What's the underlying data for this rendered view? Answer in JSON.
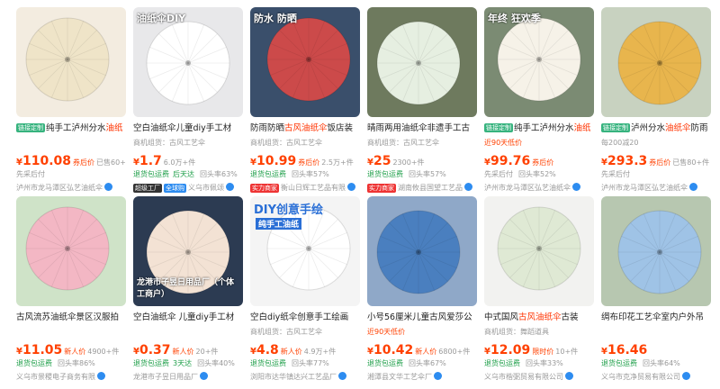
{
  "products": [
    {
      "title_tag": "链接定制",
      "title_pre": "纯手工泸州分水",
      "title_hl": "油纸",
      "sub": "",
      "price": "110.08",
      "price_tag": "券后价",
      "sales": "已售60+件",
      "extra": "先采后付",
      "shop": "泸州市龙马潭区弘艺油纸伞",
      "colors": {
        "bg": "#f3ece0",
        "umb": "#efe4c8"
      }
    },
    {
      "title_tag": "",
      "title_pre": "空白油纸伞儿童diy手工材",
      "title_hl": "",
      "sub": "商机组货：古风工艺伞",
      "price": "1.7",
      "price_tag": "",
      "sales": "6.0万+件",
      "extra_green": "退货包运费",
      "extra_green2": "后天达",
      "extra_right": "回头率63%",
      "shop_badge": "超级工厂",
      "shop_badge2": "全球购",
      "shop": "义乌市佩颂",
      "img_text": "油纸伞DIY",
      "colors": {
        "bg": "#e8e8ea",
        "umb": "#ffffff"
      }
    },
    {
      "title_tag": "",
      "title_pre": "防雨防晒",
      "title_hl": "古风油纸伞",
      "title_post": "饭店装",
      "sub": "商机组货：古风工艺伞",
      "price": "10.99",
      "price_tag": "券后价",
      "sales": "2.5万+件",
      "extra_green": "退货包运费",
      "extra_right": "回头率57%",
      "shop_badge": "实力商家",
      "shop": "衡山日辉工艺品有限",
      "img_text": "防水 防晒",
      "colors": {
        "bg": "#3a4f6b",
        "umb": "#cc4a4a"
      }
    },
    {
      "title_tag": "",
      "title_pre": "晴雨两用油纸伞非遗手工古",
      "title_hl": "",
      "sub": "商机组货：古风工艺伞",
      "price": "25",
      "price_tag": "",
      "sales": "2300+件",
      "extra_green": "退货包运费",
      "extra_right": "回头率57%",
      "shop_badge": "实力商家",
      "shop": "湖南攸县国望工艺品",
      "colors": {
        "bg": "#6e7a5e",
        "umb": "#e6efe1"
      }
    },
    {
      "title_tag": "链接定制",
      "title_pre": "纯手工泸州分水",
      "title_hl": "油纸",
      "sub": "近90天低价",
      "sub_red": true,
      "price": "99.76",
      "price_tag": "券后价",
      "sales": "",
      "extra": "先采后付",
      "extra_right": "回头率52%",
      "shop": "泸州市龙马潭区弘艺油纸伞",
      "img_text": "年终 狂欢季",
      "colors": {
        "bg": "#7b8b73",
        "umb": "#f6f2e8"
      }
    },
    {
      "title_tag": "链接定制",
      "title_pre": "泸州分水",
      "title_hl": "油纸伞",
      "title_post": "防雨",
      "sub": "每200减20",
      "price": "293.3",
      "price_tag": "券后价",
      "sales": "已售80+件",
      "extra": "先采后付",
      "shop": "泸州市龙马潭区弘艺油纸伞",
      "colors": {
        "bg": "#c8d2c0",
        "umb": "#e8b54d"
      }
    },
    {
      "title_tag": "",
      "title_pre": "古风流苏油纸伞景区汉服拍",
      "title_hl": "",
      "sub": "",
      "price": "11.05",
      "price_tag": "新人价",
      "sales": "4900+件",
      "extra_green": "退货包运费",
      "extra_right": "回头率86%",
      "shop": "义乌市景稷电子商务有限",
      "colors": {
        "bg": "#cfe3c8",
        "umb": "#f3b7c4"
      }
    },
    {
      "title_tag": "",
      "title_pre": "空白油纸伞 儿童diy手工材",
      "title_hl": "",
      "sub": "",
      "price": "0.37",
      "price_tag": "新人价",
      "sales": "20+件",
      "extra_green": "退货包运费",
      "extra_green2": "3天达",
      "extra_right": "回头率40%",
      "shop": "龙港市子昱日用品厂",
      "img_text": "龙港市子昱日用品厂（个体工商户）",
      "colors": {
        "bg": "#2c3b52",
        "umb": "#f3e2d4"
      }
    },
    {
      "title_tag": "",
      "title_pre": "空白diy纸伞创意手工绘画",
      "title_hl": "",
      "sub": "商机组货：古风工艺伞",
      "price": "4.8",
      "price_tag": "新人价",
      "sales": "4.9万+件",
      "extra_green": "退货包运费",
      "extra_right": "回头率77%",
      "shop": "浏阳市达华镇达兴工艺品厂",
      "img_text": "DIY创意手绘",
      "img_text2": "纯手工油纸",
      "colors": {
        "bg": "#f4f4f4",
        "umb": "#ffffff"
      }
    },
    {
      "title_tag": "",
      "title_pre": "小号56厘米儿童古风爱莎公",
      "title_hl": "",
      "sub": "近90天低价",
      "sub_red": true,
      "price": "10.42",
      "price_tag": "新人价",
      "sales": "6800+件",
      "extra_green": "退货包运费",
      "extra_right": "回头率67%",
      "shop": "湘潭县文华工艺伞厂",
      "colors": {
        "bg": "#8fa8c8",
        "umb": "#4a7fbf"
      }
    },
    {
      "title_tag": "",
      "title_pre": "中式国风",
      "title_hl": "古风油纸伞",
      "title_post": "古装",
      "sub": "商机组货：舞蹈道具",
      "price": "12.09",
      "price_tag": "限时价",
      "sales": "10+件",
      "extra_green": "退货包运费",
      "extra_right": "回头率33%",
      "shop": "义乌市楷弼贸易有限公司",
      "colors": {
        "bg": "#f2f2f0",
        "umb": "#dfe9d4"
      }
    },
    {
      "title_tag": "",
      "title_pre": "绸布印花工艺伞室内户外吊",
      "title_hl": "",
      "sub": "",
      "price": "16.46",
      "price_tag": "",
      "sales": "",
      "extra_green": "退货包运费",
      "extra_right": "回头率64%",
      "shop": "义乌市克净贸易有限公司",
      "colors": {
        "bg": "#b7c7b0",
        "umb": "#9fc3e6"
      }
    }
  ],
  "currency": "¥",
  "verified_mark": "certified-badge-icon"
}
